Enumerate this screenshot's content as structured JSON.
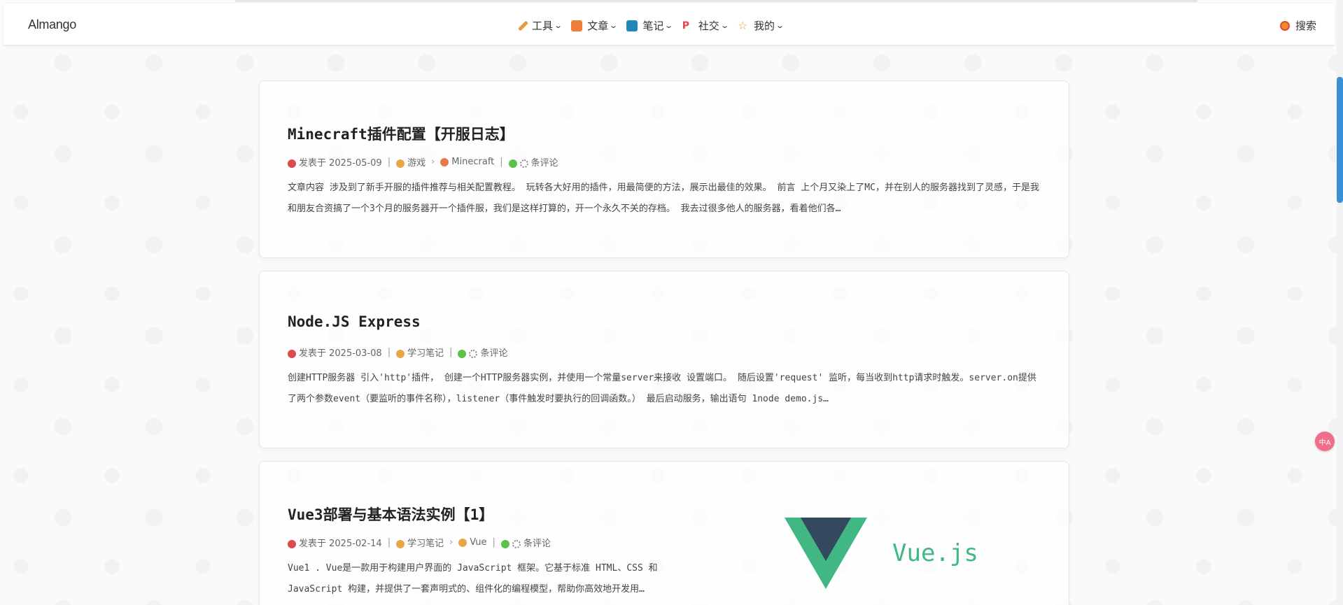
{
  "header": {
    "logo": "Almango",
    "nav": [
      {
        "label": "工具",
        "icon": "pencil-icon",
        "color": "#e89a3c"
      },
      {
        "label": "文章",
        "icon": "document-icon",
        "color": "#f07d3a"
      },
      {
        "label": "笔记",
        "icon": "notebook-icon",
        "color": "#1e88b8"
      },
      {
        "label": "社交",
        "icon": "pinterest-icon",
        "color": "#e2474b"
      },
      {
        "label": "我的",
        "icon": "star-icon",
        "color": "#e0a52a"
      }
    ],
    "search_label": "搜索"
  },
  "posts": [
    {
      "title": "Minecraft插件配置【开服日志】",
      "date": "发表于 2025-05-09",
      "category": "游戏",
      "subcategory": "Minecraft",
      "comments": "条评论",
      "excerpt": "文章内容 涉及到了新手开服的插件推荐与相关配置教程。 玩转各大好用的插件，用最简便的方法，展示出最佳的效果。 前言 上个月又染上了MC，并在别人的服务器找到了灵感，于是我和朋友合资搞了一个3个月的服务器开一个插件服，我们是这样打算的，开一个永久不关的存档。 我去过很多他人的服务器，看着他们各…"
    },
    {
      "title": "Node.JS Express",
      "date": "发表于 2025-03-08",
      "category": "学习笔记",
      "subcategory": "",
      "comments": "条评论",
      "excerpt": "创建HTTP服务器 引入'http'插件， 创建一个HTTP服务器实例，并使用一个常量server来接收 设置端口。 随后设置'request' 监听，每当收到http请求时触发。server.on提供了两个参数event（要监听的事件名称），listener（事件触发时要执行的回调函数。） 最后启动服务，输出语句 1node demo.js…"
    },
    {
      "title": "Vue3部署与基本语法实例【1】",
      "date": "发表于 2025-02-14",
      "category": "学习笔记",
      "subcategory": "Vue",
      "comments": "条评论",
      "excerpt": "Vue1 . Vue是一款用于构建用户界面的 JavaScript 框架。它基于标准 HTML、CSS 和 JavaScript 构建，并提供了一套声明式的、组件化的编程模型，帮助你高效地开发用…",
      "image_text": "Vue.js"
    }
  ],
  "translate_label": "中A"
}
